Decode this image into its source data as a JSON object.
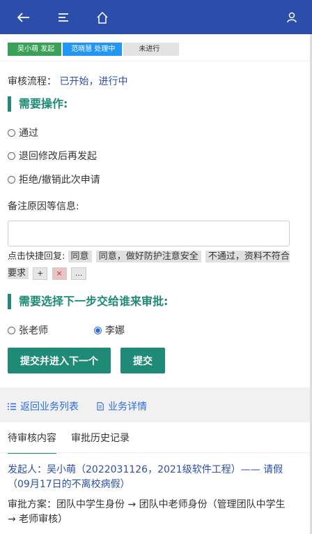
{
  "steps": [
    "吴小萌 发起",
    "范晓慧 处理中",
    "未进行"
  ],
  "flow": {
    "label": "审核流程：",
    "value": "已开始，进行中"
  },
  "ops": {
    "heading": "需要操作:",
    "options": [
      "通过",
      "退回修改后再发起",
      "拒绝/撤销此次申请"
    ]
  },
  "remark": {
    "label": "备注原因等信息:",
    "value": ""
  },
  "quick": {
    "label": "点击快捷回复:",
    "chips": [
      "同意",
      "同意，做好防护注意安全",
      "不通过，资料不符合要求"
    ],
    "add": "+",
    "remove": "×",
    "more": "..."
  },
  "next": {
    "heading": "需要选择下一步交给谁来审批:",
    "options": [
      "张老师",
      "李娜"
    ],
    "selected": "李娜"
  },
  "buttons": {
    "submit_next": "提交并进入下一个",
    "submit": "提交"
  },
  "links": {
    "back": "返回业务列表",
    "detail": "业务详情"
  },
  "tabs": [
    "待审核内容",
    "审批历史记录"
  ],
  "content": {
    "initiator": "发起人：吴小萌（2022031126，2021级软件工程）—— 请假（09月17日的不离校病假）",
    "plan": "审批方案：团队中学生身份 → 团队中老师身份（管理团队中学生 → 老师审核）"
  },
  "colors": {
    "topbar": "#2b4eaa",
    "accent": "#1f8a75",
    "link": "#2b6de0"
  }
}
